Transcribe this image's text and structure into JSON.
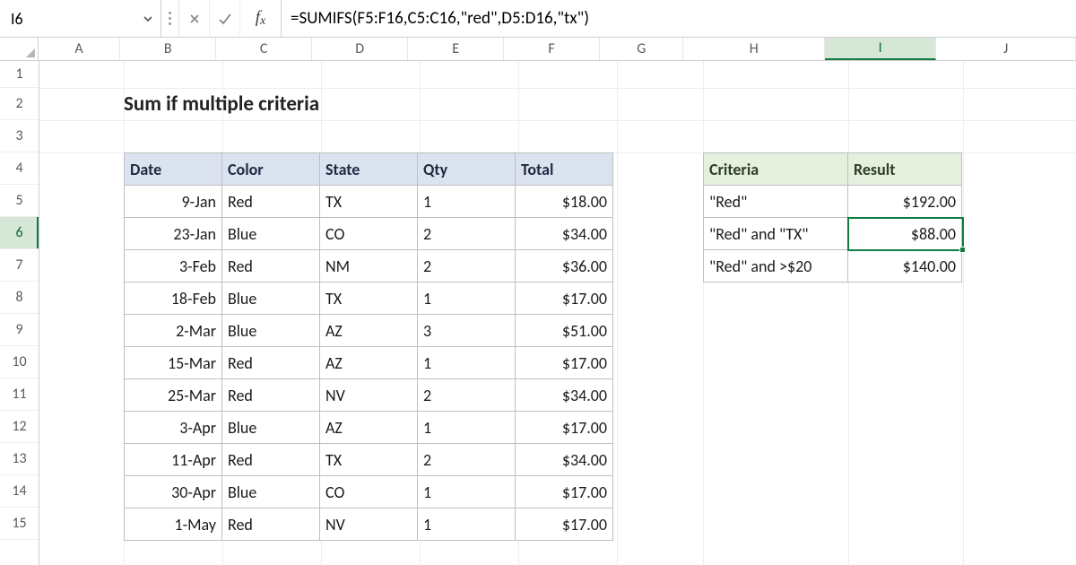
{
  "active_cell_ref": "I6",
  "formula": "=SUMIFS(F5:F16,C5:C16,\"red\",D5:D16,\"tx\")",
  "columns": [
    "A",
    "B",
    "C",
    "D",
    "E",
    "F",
    "G",
    "H",
    "I",
    "J"
  ],
  "rows": [
    "1",
    "2",
    "3",
    "4",
    "5",
    "6",
    "7",
    "8",
    "9",
    "10",
    "11",
    "12",
    "13",
    "14",
    "15"
  ],
  "active_col": "I",
  "active_row": "6",
  "title": "Sum if multiple criteria",
  "main_table": {
    "headers": {
      "date": "Date",
      "color": "Color",
      "state": "State",
      "qty": "Qty",
      "total": "Total"
    },
    "rows": [
      {
        "date": "9-Jan",
        "color": "Red",
        "state": "TX",
        "qty": "1",
        "total": "$18.00"
      },
      {
        "date": "23-Jan",
        "color": "Blue",
        "state": "CO",
        "qty": "2",
        "total": "$34.00"
      },
      {
        "date": "3-Feb",
        "color": "Red",
        "state": "NM",
        "qty": "2",
        "total": "$36.00"
      },
      {
        "date": "18-Feb",
        "color": "Blue",
        "state": "TX",
        "qty": "1",
        "total": "$17.00"
      },
      {
        "date": "2-Mar",
        "color": "Blue",
        "state": "AZ",
        "qty": "3",
        "total": "$51.00"
      },
      {
        "date": "15-Mar",
        "color": "Red",
        "state": "AZ",
        "qty": "1",
        "total": "$17.00"
      },
      {
        "date": "25-Mar",
        "color": "Red",
        "state": "NV",
        "qty": "2",
        "total": "$34.00"
      },
      {
        "date": "3-Apr",
        "color": "Blue",
        "state": "AZ",
        "qty": "1",
        "total": "$17.00"
      },
      {
        "date": "11-Apr",
        "color": "Red",
        "state": "TX",
        "qty": "2",
        "total": "$34.00"
      },
      {
        "date": "30-Apr",
        "color": "Blue",
        "state": "CO",
        "qty": "1",
        "total": "$17.00"
      },
      {
        "date": "1-May",
        "color": "Red",
        "state": "NV",
        "qty": "1",
        "total": "$17.00"
      }
    ]
  },
  "side_table": {
    "headers": {
      "criteria": "Criteria",
      "result": "Result"
    },
    "rows": [
      {
        "criteria": "\"Red\"",
        "result": "$192.00"
      },
      {
        "criteria": "\"Red\" and \"TX\"",
        "result": "$88.00"
      },
      {
        "criteria": "\"Red\" and >$20",
        "result": "$140.00"
      }
    ]
  }
}
